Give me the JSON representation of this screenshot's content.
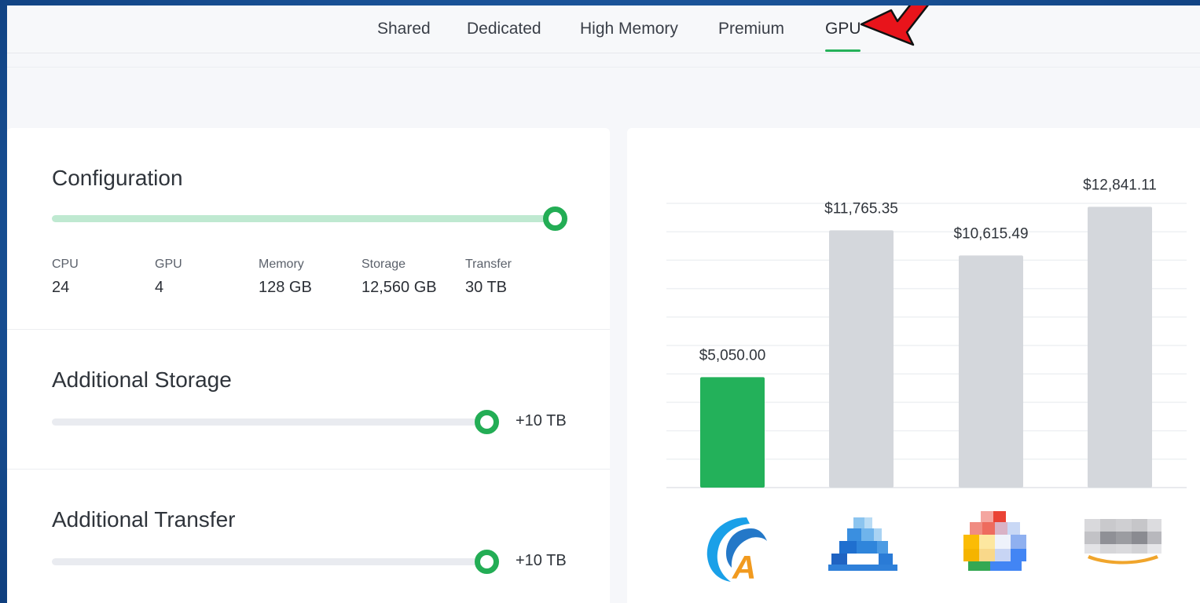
{
  "tabs": [
    "Shared",
    "Dedicated",
    "High Memory",
    "Premium",
    "GPU"
  ],
  "active_tab": "GPU",
  "configuration": {
    "title": "Configuration",
    "slider_level": 1.0,
    "stats": [
      {
        "label": "CPU",
        "value": "24"
      },
      {
        "label": "GPU",
        "value": "4"
      },
      {
        "label": "Memory",
        "value": "128 GB"
      },
      {
        "label": "Storage",
        "value": "12,560 GB"
      },
      {
        "label": "Transfer",
        "value": "30 TB"
      }
    ]
  },
  "additional_storage": {
    "title": "Additional Storage",
    "value": "+10 TB",
    "slider_level": 1.0
  },
  "additional_transfer": {
    "title": "Additional Transfer",
    "value": "+10 TB",
    "slider_level": 1.0
  },
  "chart_data": {
    "type": "bar",
    "categories": [
      "provider-a-logo",
      "provider-blue-logo",
      "provider-cloud-logo",
      "provider-smile-logo"
    ],
    "values": [
      5050.0,
      11765.35,
      10615.49,
      12841.11
    ],
    "value_labels": [
      "$5,050.00",
      "$11,765.35",
      "$10,615.49",
      "$12,841.11"
    ],
    "ylim": [
      0,
      13000
    ],
    "grid": true,
    "colors": [
      "#23b15a",
      "#d4d7dc",
      "#d4d7dc",
      "#d4d7dc"
    ]
  },
  "colors": {
    "accent": "#23ad55",
    "track": "#e9ebf0",
    "track_filled": "#bfe9d1",
    "arrow": "#e8141b"
  }
}
